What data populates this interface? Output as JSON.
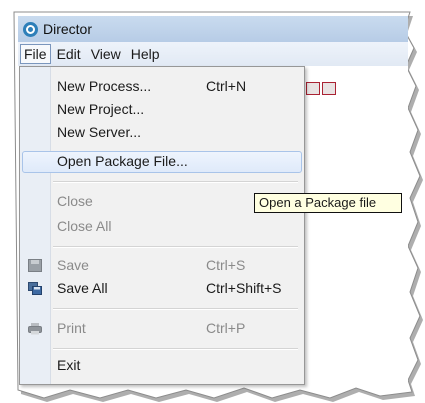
{
  "window": {
    "title": "Director"
  },
  "menubar": {
    "items": [
      "File",
      "Edit",
      "View",
      "Help"
    ]
  },
  "file_menu": {
    "groups": [
      [
        {
          "label": "New Process...",
          "shortcut": "Ctrl+N",
          "enabled": true
        },
        {
          "label": "New Project...",
          "shortcut": "",
          "enabled": true
        },
        {
          "label": "New Server...",
          "shortcut": "",
          "enabled": true
        },
        {
          "label": "Open Package File...",
          "shortcut": "",
          "enabled": true,
          "highlighted": true
        }
      ],
      [
        {
          "label": "Close",
          "shortcut": "",
          "enabled": false
        },
        {
          "label": "Close All",
          "shortcut": "",
          "enabled": false
        }
      ],
      [
        {
          "label": "Save",
          "shortcut": "Ctrl+S",
          "enabled": false,
          "icon": "save-icon"
        },
        {
          "label": "Save All",
          "shortcut": "Ctrl+Shift+S",
          "enabled": true,
          "icon": "save-all-icon"
        }
      ],
      [
        {
          "label": "Print",
          "shortcut": "Ctrl+P",
          "enabled": false,
          "icon": "print-icon"
        }
      ],
      [
        {
          "label": "Exit",
          "shortcut": "",
          "enabled": true
        }
      ]
    ]
  },
  "tooltip": {
    "text": "Open a Package file"
  },
  "colors": {
    "titlebar": "#c2d6ee",
    "menubar": "#e6edf6",
    "menu_bg": "#f1f1f1",
    "highlight": "#dfeafa",
    "tooltip_bg": "#ffffe1"
  }
}
